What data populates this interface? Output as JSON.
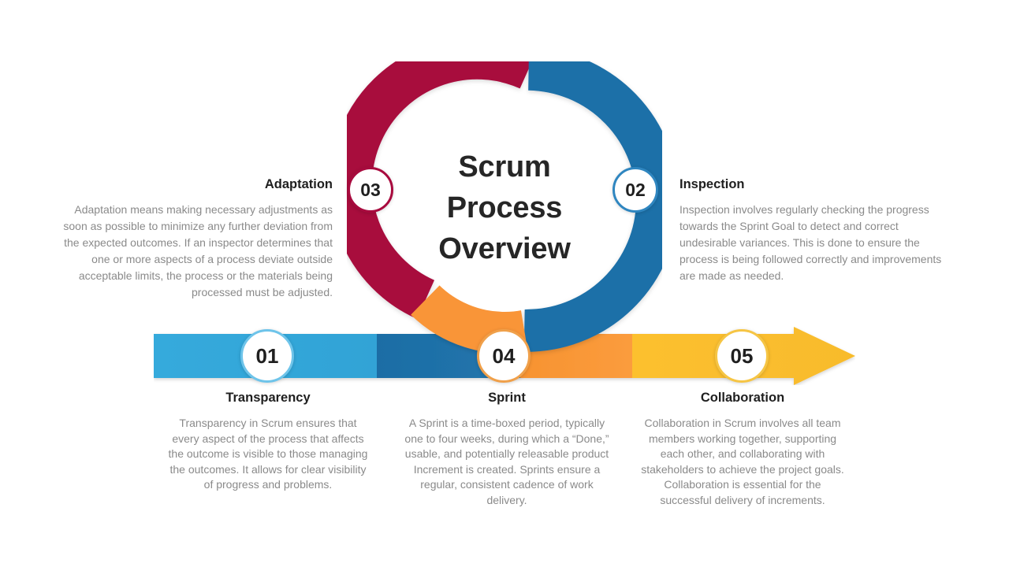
{
  "center": {
    "title_lines": [
      "Scrum",
      "Process",
      "Overview"
    ]
  },
  "badges": {
    "b01": "01",
    "b02": "02",
    "b03": "03",
    "b04": "04",
    "b05": "05"
  },
  "steps": [
    {
      "number": "01",
      "title": "Transparency",
      "body": "Transparency in Scrum ensures that every aspect of the process that affects the outcome is visible to those managing the outcomes. It allows for clear visibility of progress and problems.",
      "color": "#35aadc"
    },
    {
      "number": "02",
      "title": "Inspection",
      "body": "Inspection involves regularly checking the progress towards the Sprint Goal to detect and correct undesirable variances. This is done to ensure the process is being followed correctly and improvements are made as needed.",
      "color": "#1f6fa8"
    },
    {
      "number": "03",
      "title": "Adaptation",
      "body": "Adaptation means making necessary adjustments as soon as possible to minimize any further deviation from the expected outcomes. If an inspector determines that one or more aspects of a process deviate outside acceptable limits, the process or the materials being processed must be adjusted.",
      "color": "#a80a3e"
    },
    {
      "number": "04",
      "title": "Sprint",
      "body": "A Sprint is a time-boxed period, typically one to four weeks, during which a “Done,” usable, and potentially releasable product Increment is created. Sprints ensure a regular, consistent cadence of work delivery.",
      "color": "#f99538"
    },
    {
      "number": "05",
      "title": "Collaboration",
      "body": "Collaboration in Scrum involves all team members working together, supporting each other, and collaborating with stakeholders to achieve the project goals. Collaboration is essential for the successful delivery of increments.",
      "color": "#fbbf2e"
    }
  ],
  "colors": {
    "crimson": "#a80a3e",
    "donut_blue": "#1f6fa8",
    "donut_orange": "#f99538",
    "bar_light_blue": "#35aadc",
    "bar_dark_blue": "#1f6fa8",
    "bar_orange": "#f99538",
    "bar_yellow": "#fbbf2e",
    "text_dark": "#1f1f1f",
    "text_muted": "#8a8a8a",
    "background": "#ffffff"
  }
}
